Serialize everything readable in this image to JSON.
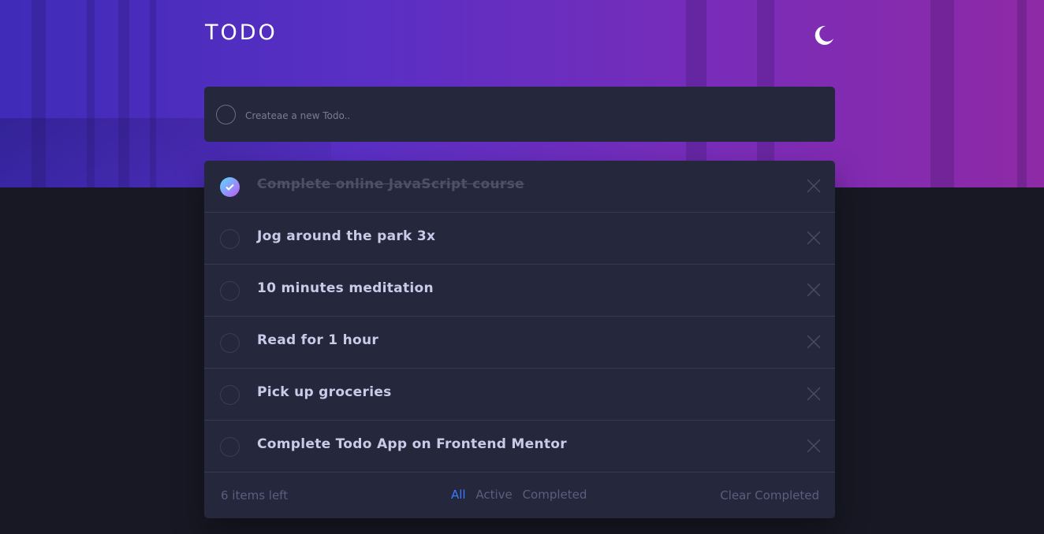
{
  "app": {
    "title": "TODO",
    "theme_icon": "moon-icon"
  },
  "new_todo": {
    "placeholder": "Createae a new Todo.."
  },
  "todos": [
    {
      "text": "Complete online JavaScript course",
      "completed": true
    },
    {
      "text": "Jog around the park 3x",
      "completed": false
    },
    {
      "text": "10 minutes meditation",
      "completed": false
    },
    {
      "text": "Read for 1 hour",
      "completed": false
    },
    {
      "text": "Pick up groceries",
      "completed": false
    },
    {
      "text": "Complete Todo App on Frontend Mentor",
      "completed": false
    }
  ],
  "footer": {
    "items_left": "6 items left",
    "filters": [
      "All",
      "Active",
      "Completed"
    ],
    "active_filter": "All",
    "clear_label": "Clear Completed"
  },
  "colors": {
    "accent": "#3a7bfd",
    "check_gradient_start": "#57ddff",
    "check_gradient_end": "#c058f3",
    "card_bg": "#25273c",
    "page_bg": "#181824"
  }
}
